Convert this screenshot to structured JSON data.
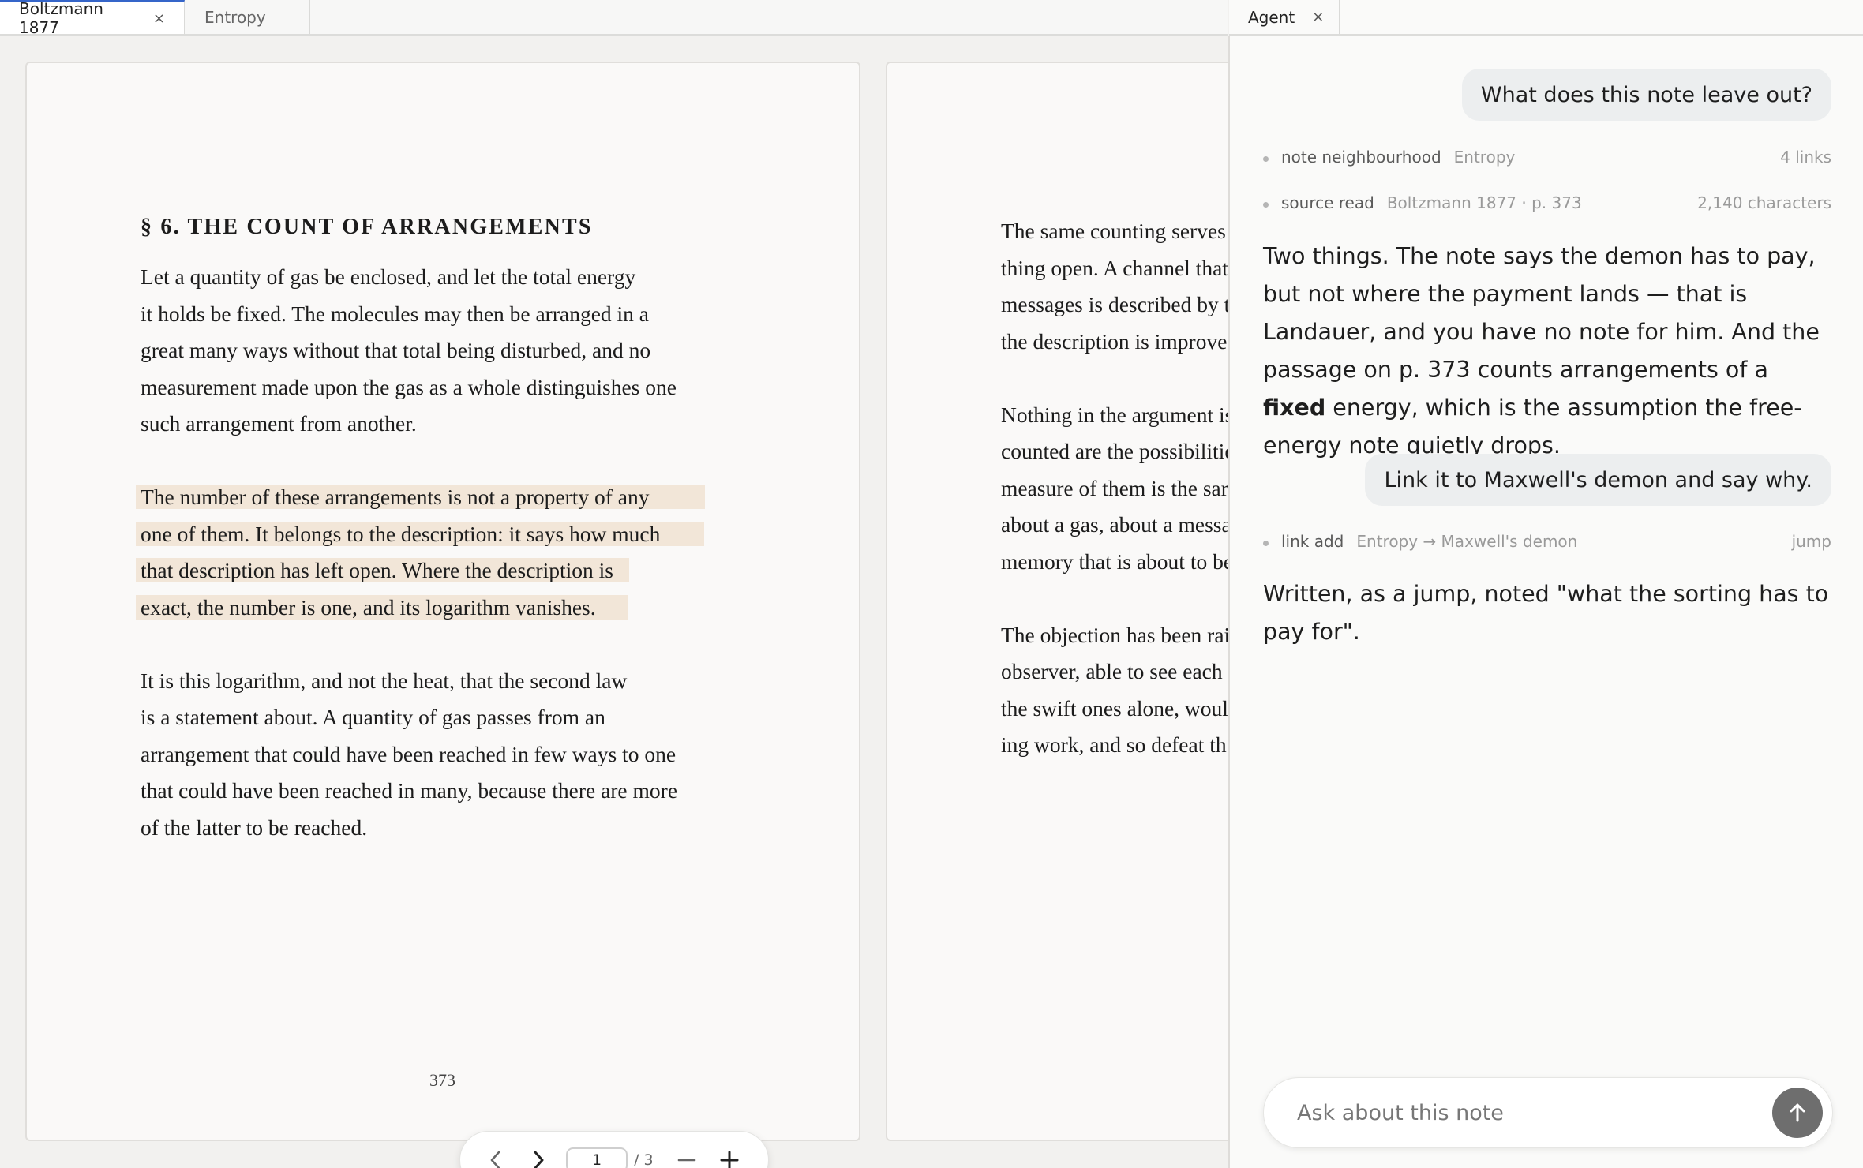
{
  "tabs": {
    "left": [
      {
        "label": "Boltzmann 1877",
        "close": "×"
      },
      {
        "label": "Entropy"
      }
    ],
    "right": [
      {
        "label": "Agent",
        "close": "×"
      }
    ]
  },
  "page1": {
    "title": "§ 6. THE COUNT OF ARRANGEMENTS",
    "para1": [
      "Let a quantity of gas be enclosed, and let the total energy",
      "it holds be fixed. The molecules may then be arranged in a",
      "great many ways without that total being disturbed, and no",
      "measurement made upon the gas as a whole distinguishes one",
      "such arrangement from another."
    ],
    "para2": [
      "The number of these arrangements is not a property of any",
      "one of them. It belongs to the description: it says how much",
      "that description has left open. Where the description is",
      "exact, the number is one, and its logarithm vanishes."
    ],
    "para3": [
      "It is this logarithm, and not the heat, that the second law",
      "is a statement about. A quantity of gas passes from an",
      "arrangement that could have been reached in few ways to one",
      "that could have been reached in many, because there are more",
      "of the latter to be reached."
    ],
    "page_number": "373"
  },
  "page2": {
    "para1": [
      "The same counting serves",
      "thing open. A channel that",
      "messages is described by t",
      "the description is improve"
    ],
    "para2": [
      "Nothing in the argument is",
      "counted are the possibilitie",
      "measure of them is the sar",
      "about a gas, about a messa",
      "memory that is about to be"
    ],
    "para3": [
      "The objection has been rai",
      "observer, able to see each",
      "the swift ones alone, woul",
      "ing work, and so defeat th"
    ]
  },
  "nav": {
    "current_page": "1",
    "total": "/ 3"
  },
  "agent": {
    "user_msg1": "What does this note leave out?",
    "tool1": {
      "name": "note neighbourhood",
      "detail": "Entropy",
      "meta": "4 links"
    },
    "tool2": {
      "name": "source read",
      "detail": "Boltzmann 1877 · p. 373",
      "meta": "2,140 characters"
    },
    "reply1": {
      "before": "Two things. The note says the demon has to pay, but not where the payment lands — that is Landauer, and you have no note for him. And the passage on p. 373 counts arrangements of a ",
      "bold": "fixed",
      "after": " energy, which is the assumption the free-energy note quietly drops."
    },
    "user_msg2": "Link it to Maxwell's demon and say why.",
    "tool3": {
      "name": "link add",
      "detail": "Entropy → Maxwell's demon",
      "meta": "jump"
    },
    "reply2": "Written, as a jump, noted \"what the sorting has to pay for\".",
    "input_placeholder": "Ask about this note"
  },
  "colors": {
    "accent": "#3565c9",
    "highlight": "#f2e6d8",
    "bubble": "#eceeef",
    "send_button": "#6e6e6e"
  }
}
